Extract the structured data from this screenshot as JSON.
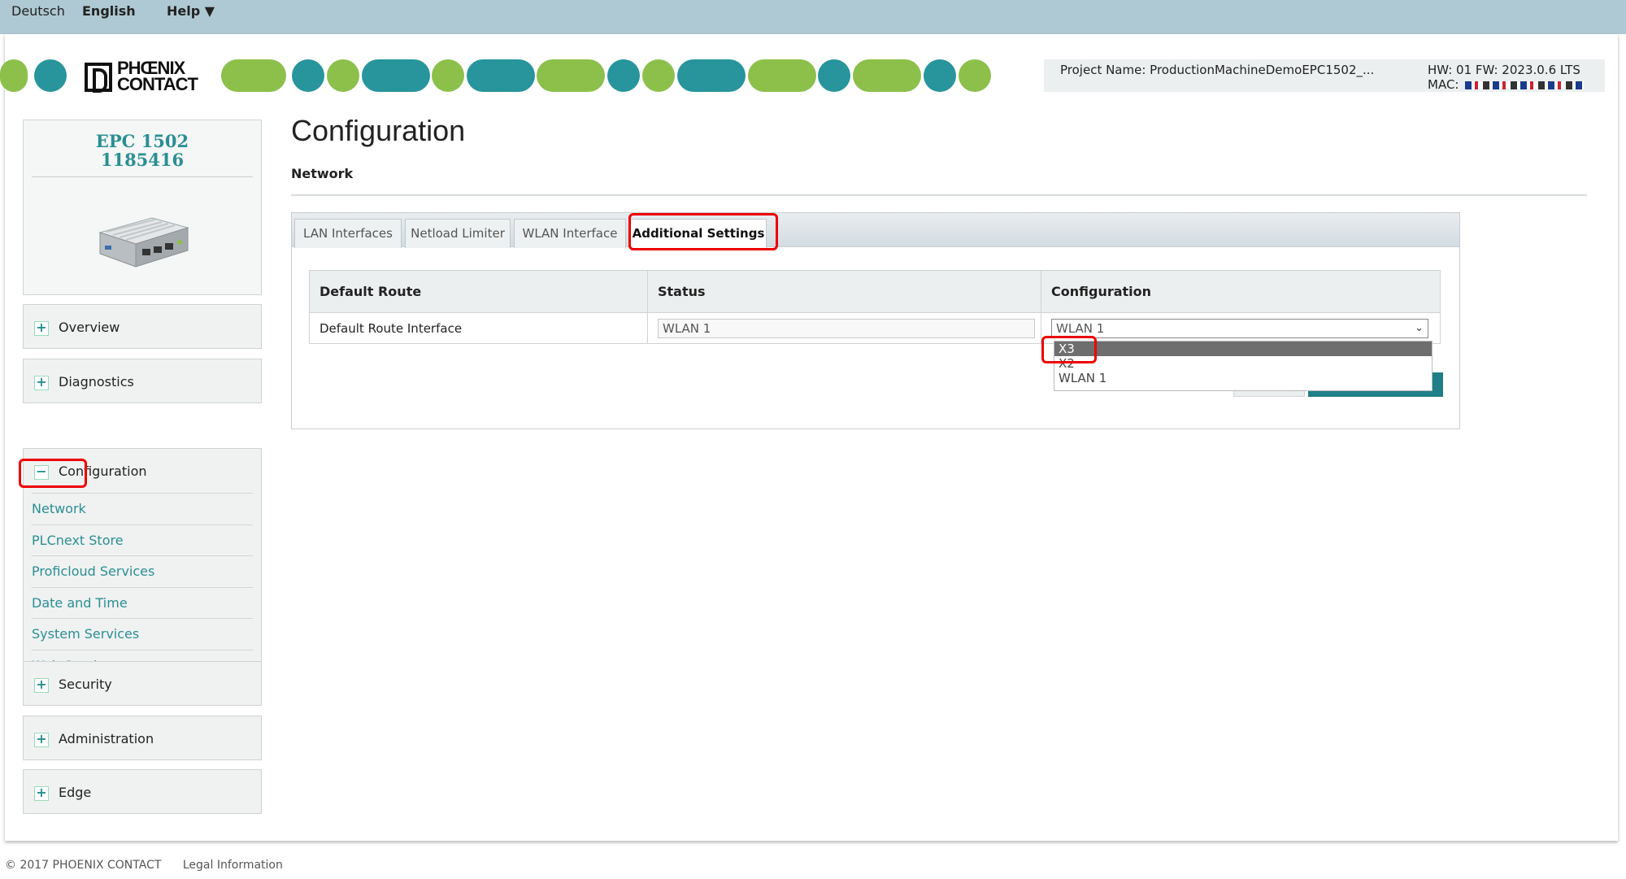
{
  "topbar": {
    "lang_de": "Deutsch",
    "lang_en": "English",
    "help": "Help ▼"
  },
  "header": {
    "logo_name_line1": "PHŒNIX",
    "logo_name_line2": "CONTACT",
    "project_name": "Project Name: ProductionMachineDemoEPC1502_...",
    "hw_fw": "HW: 01 FW: 2023.0.6 LTS",
    "mac_label": "MAC:"
  },
  "colors": {
    "accent": "#2a8f93",
    "green": "#8cc04b",
    "teal": "#27959b",
    "highlight": "#e00000"
  },
  "device": {
    "model": "EPC 1502",
    "order_no": "1185416"
  },
  "sidebar": {
    "overview": "Overview",
    "diagnostics": "Diagnostics",
    "configuration": "Configuration",
    "config_items": [
      "Network",
      "PLCnext Store",
      "Proficloud Services",
      "Date and Time",
      "System Services",
      "Web Services"
    ],
    "security": "Security",
    "administration": "Administration",
    "edge": "Edge",
    "expand_icon": "+",
    "collapse_icon": "−"
  },
  "main": {
    "title": "Configuration",
    "section": "Network",
    "tabs": [
      "LAN Interfaces",
      "Netload Limiter",
      "WLAN Interface",
      "Additional Settings"
    ],
    "table": {
      "headers": [
        "Default Route",
        "Status",
        "Configuration"
      ],
      "row_label": "Default Route Interface",
      "status_value": "WLAN 1",
      "config_value": "WLAN 1"
    },
    "dropdown_options": [
      "X3",
      "X2",
      "WLAN 1"
    ]
  },
  "footer": {
    "copyright": "© 2017 PHOENIX CONTACT",
    "legal": "Legal Information"
  }
}
